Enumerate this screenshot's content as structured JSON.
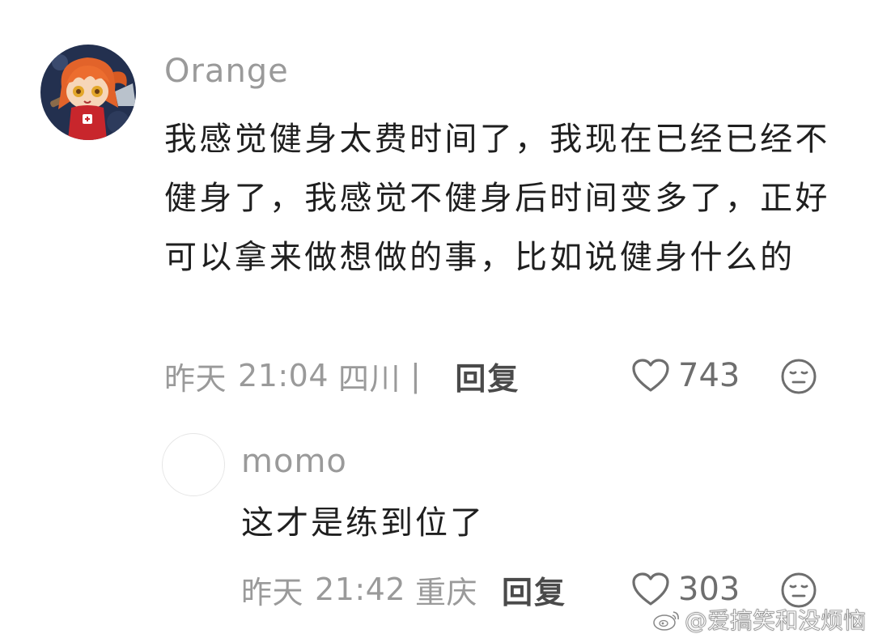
{
  "comment": {
    "username": "Orange",
    "text": "我感觉健身太费时间了，我现在已经已经不健身了，我感觉不健身后时间变多了，正好可以拿来做想做的事，比如说健身什么的",
    "date": "昨天",
    "time": "21:04",
    "location": "四川",
    "separator": "|",
    "reply_label": "回复",
    "like_count": "743"
  },
  "reply": {
    "username": "momo",
    "text": "这才是练到位了",
    "date": "昨天",
    "time": "21:42",
    "location": "重庆",
    "reply_label": "回复",
    "like_count": "303"
  },
  "watermark": {
    "text": "@爱搞笑和没烦恼"
  },
  "icons": {
    "like": "heart-outline-icon",
    "emoji": "neutral-face-icon",
    "watermark": "weibo-logo-icon"
  },
  "colors": {
    "text_primary": "#1f1f1f",
    "text_secondary": "#9a9a9a",
    "reply_button": "#4a4a4a",
    "avatar_bg": "#23304f",
    "avatar_hair": "#e2632a"
  }
}
